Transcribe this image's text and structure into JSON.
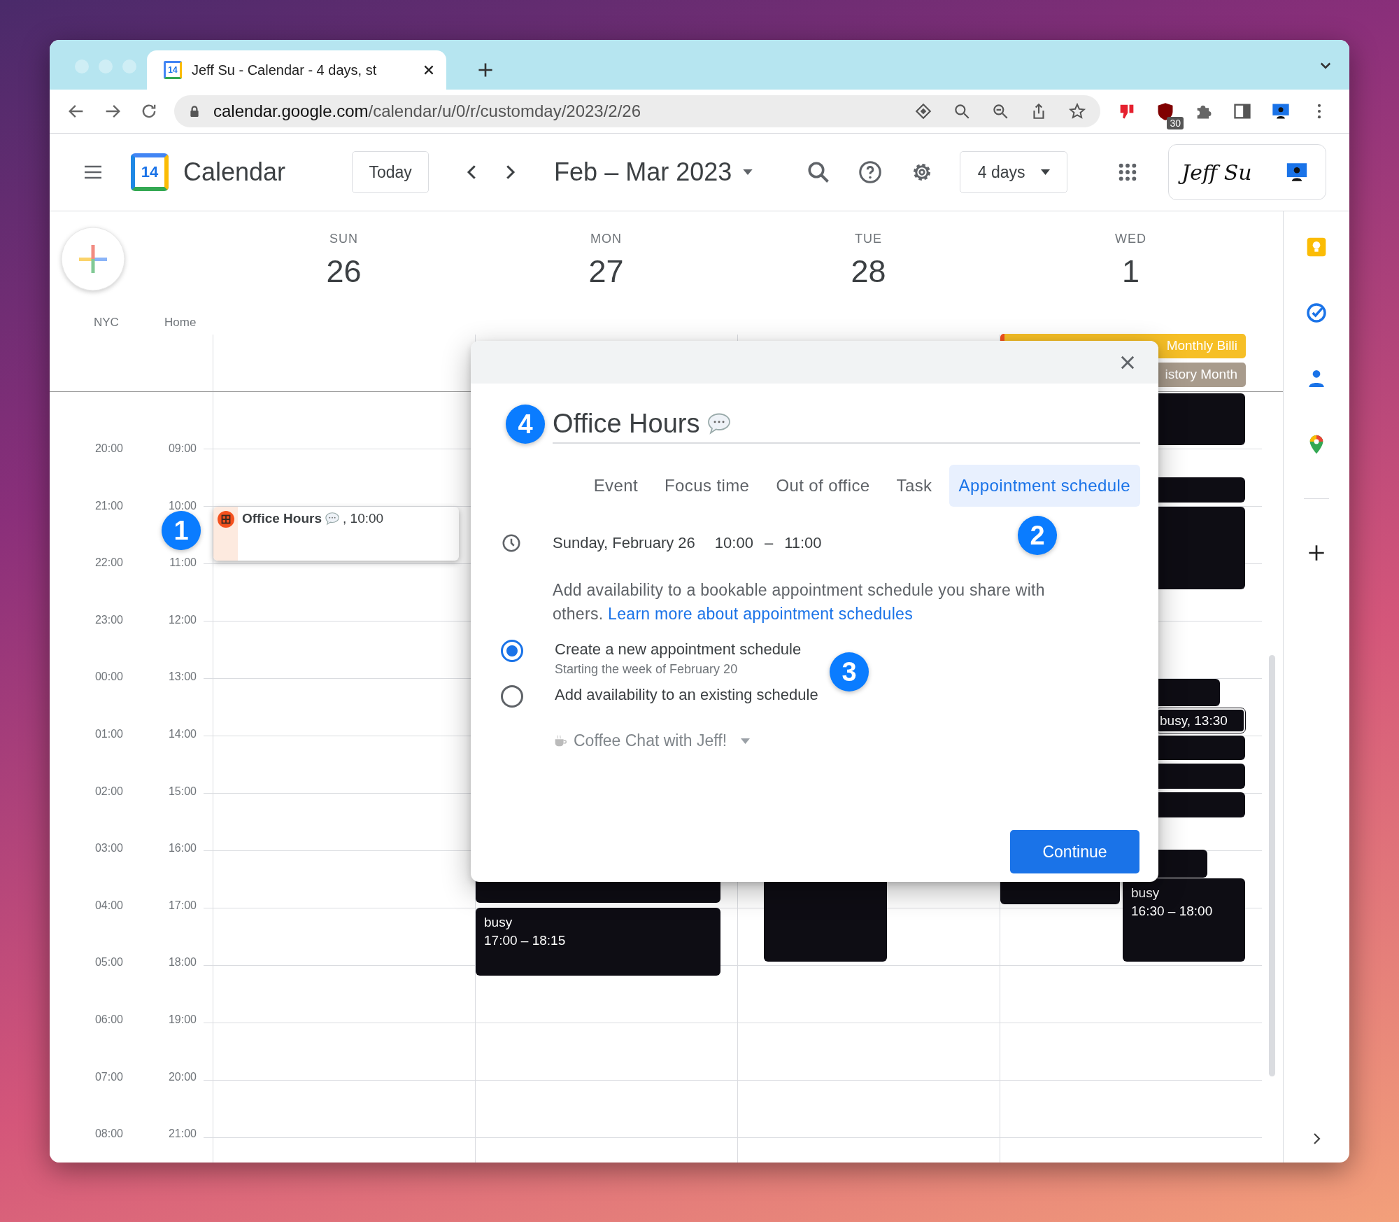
{
  "browser": {
    "tab_title": "Jeff Su - Calendar - 4 days, st",
    "tab_icon_day": "14",
    "url_host": "calendar.google.com",
    "url_path": "/calendar/u/0/r/customday/2023/2/26",
    "extension_badge": "30"
  },
  "header": {
    "logo_day": "14",
    "app_name": "Calendar",
    "today_button": "Today",
    "date_range": "Feb – Mar 2023",
    "view_button": "4 days",
    "signature": "Jeff Su"
  },
  "timezones": [
    "NYC",
    "Home"
  ],
  "hours": [
    {
      "primary": "20:00",
      "secondary": "09:00"
    },
    {
      "primary": "21:00",
      "secondary": "10:00"
    },
    {
      "primary": "22:00",
      "secondary": "11:00"
    },
    {
      "primary": "23:00",
      "secondary": "12:00"
    },
    {
      "primary": "00:00",
      "secondary": "13:00"
    },
    {
      "primary": "01:00",
      "secondary": "14:00"
    },
    {
      "primary": "02:00",
      "secondary": "15:00"
    },
    {
      "primary": "03:00",
      "secondary": "16:00"
    },
    {
      "primary": "04:00",
      "secondary": "17:00"
    },
    {
      "primary": "05:00",
      "secondary": "18:00"
    },
    {
      "primary": "06:00",
      "secondary": "19:00"
    },
    {
      "primary": "07:00",
      "secondary": "20:00"
    },
    {
      "primary": "08:00",
      "secondary": "21:00"
    }
  ],
  "days": [
    {
      "weekday": "SUN",
      "date": "26",
      "events": [
        {
          "kind": "appointment",
          "title": "Office Hours",
          "time": ", 10:00"
        }
      ]
    },
    {
      "weekday": "MON",
      "date": "27",
      "events": [
        {
          "kind": "busy"
        },
        {
          "kind": "busy",
          "title": "busy",
          "time": "17:00 – 18:15"
        }
      ]
    },
    {
      "weekday": "TUE",
      "date": "28",
      "events": [
        {
          "kind": "busy"
        }
      ]
    },
    {
      "weekday": "WED",
      "date": "1",
      "allday_events": [
        {
          "title": "Monthly Billi",
          "color": "#f6bf26"
        },
        {
          "title": "istory Month",
          "color": "#a89b8c"
        }
      ],
      "events": [
        {
          "kind": "busy"
        },
        {
          "kind": "busy"
        },
        {
          "kind": "busy"
        },
        {
          "kind": "busy"
        },
        {
          "kind": "busy",
          "title": "busy, 13:30"
        },
        {
          "kind": "busy"
        },
        {
          "kind": "busy"
        },
        {
          "kind": "busy"
        },
        {
          "kind": "busy"
        },
        {
          "kind": "busy"
        },
        {
          "kind": "busy",
          "title": "busy",
          "time": "16:30 – 18:00"
        }
      ]
    }
  ],
  "dialog": {
    "title": "Office Hours",
    "tabs": [
      {
        "label": "Event",
        "selected": false
      },
      {
        "label": "Focus time",
        "selected": false
      },
      {
        "label": "Out of office",
        "selected": false
      },
      {
        "label": "Task",
        "selected": false
      },
      {
        "label": "Appointment schedule",
        "selected": true
      }
    ],
    "date": "Sunday, February 26",
    "start": "10:00",
    "dash": "–",
    "end": "11:00",
    "description": "Add availability to a bookable appointment schedule you share with others.",
    "link": "Learn more about appointment schedules",
    "options": [
      {
        "label": "Create a new appointment schedule",
        "sublabel": "Starting the week of February 20",
        "selected": true
      },
      {
        "label": "Add availability to an existing schedule",
        "selected": false
      }
    ],
    "schedule_dropdown": {
      "value": "Coffee Chat with Jeff!",
      "disabled": true
    },
    "continue_button": "Continue"
  },
  "annotations": [
    "1",
    "2",
    "3",
    "4"
  ]
}
